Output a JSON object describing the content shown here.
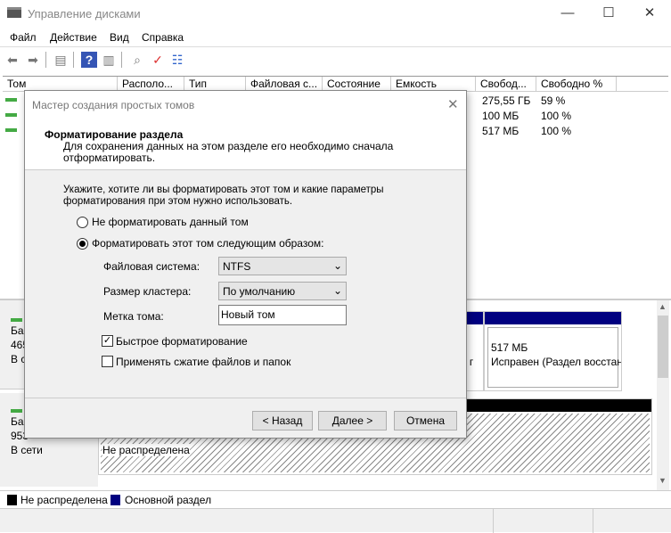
{
  "window": {
    "title": "Управление дисками",
    "controls": [
      "—",
      "☐",
      "✕"
    ]
  },
  "menu": [
    "Файл",
    "Действие",
    "Вид",
    "Справка"
  ],
  "table": {
    "columns": [
      "Том",
      "Располо...",
      "Тип",
      "Файловая с...",
      "Состояние",
      "Емкость",
      "Свобод...",
      "Свободно %"
    ],
    "rows": [
      {
        "free": "275,55 ГБ",
        "pct": "59 %"
      },
      {
        "free": "100 МБ",
        "pct": "100 %"
      },
      {
        "free": "517 МБ",
        "pct": "100 %"
      }
    ]
  },
  "disks": [
    {
      "l1": "Ба",
      "l2": "465",
      "l3": "В с"
    },
    {
      "l1": "Ба",
      "l2": "953",
      "l3": "В сети"
    }
  ],
  "partitions": {
    "recovery_size": "517 МБ",
    "recovery_status": "Исправен (Раздел восстан",
    "frag": "п г",
    "unallocated": "Не распределена"
  },
  "legend": [
    {
      "label": "Не распределена",
      "color": "#000000"
    },
    {
      "label": "Основной раздел",
      "color": "#000080"
    }
  ],
  "dialog": {
    "title": "Мастер создания простых томов",
    "heading": "Форматирование раздела",
    "subtitle": "Для сохранения данных на этом разделе его необходимо сначала отформатировать.",
    "prompt": "Укажите, хотите ли вы форматировать этот том и какие параметры форматирования при этом нужно использовать.",
    "radio_no": "Не форматировать данный том",
    "radio_yes": "Форматировать этот том следующим образом:",
    "fs_label": "Файловая система:",
    "fs_value": "NTFS",
    "cluster_label": "Размер кластера:",
    "cluster_value": "По умолчанию",
    "vol_label": "Метка тома:",
    "vol_value": "Новый том",
    "quick": "Быстрое форматирование",
    "compress": "Применять сжатие файлов и папок",
    "back": "< Назад",
    "next": "Далее >",
    "cancel": "Отмена"
  }
}
